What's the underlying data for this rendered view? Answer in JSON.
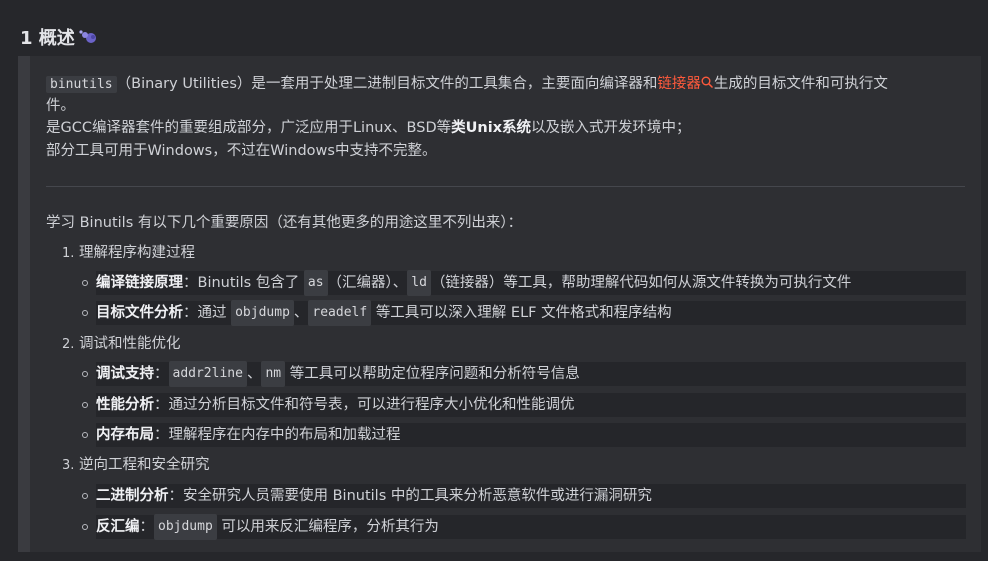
{
  "heading": {
    "title": "1 概述"
  },
  "intro": {
    "code1": "binutils",
    "text1": "（Binary Utilities）是一套用于处理二进制目标文件的工具集合，主要面向编译器和",
    "link": "链接器",
    "text2": "生成的目标文件和可执行文",
    "text3": "件。",
    "line2_a": "是GCC编译器套件的重要组成部分，广泛应用于Linux、BSD等",
    "line2_bold": "类Unix系统",
    "line2_b": "以及嵌入式开发环境中；",
    "line3": "部分工具可用于Windows，不过在Windows中支持不完整。"
  },
  "reasons": {
    "lead": "学习 Binutils 有以下几个重要原因（还有其他更多的用途这里不列出来）：",
    "items": [
      {
        "num": "1.",
        "title": "理解程序构建过程",
        "subs": [
          {
            "bold": "编译链接原理",
            "pre": "：Binutils 包含了",
            "code1": "as",
            "mid": "（汇编器）、",
            "code2": "ld",
            "post": "（链接器）等工具，帮助理解代码如何从源文件转换为可执行文件"
          },
          {
            "bold": "目标文件分析",
            "pre": "：通过",
            "code1": "objdump",
            "mid": "、",
            "code2": "readelf",
            "post": "等工具可以深入理解 ELF 文件格式和程序结构"
          }
        ]
      },
      {
        "num": "2.",
        "title": "调试和性能优化",
        "subs": [
          {
            "bold": "调试支持",
            "pre": "：",
            "code1": "addr2line",
            "mid": "、",
            "code2": "nm",
            "post": "等工具可以帮助定位程序问题和分析符号信息"
          },
          {
            "bold": "性能分析",
            "pre": "：通过分析目标文件和符号表，可以进行程序大小优化和性能调优"
          },
          {
            "bold": "内存布局",
            "pre": "：理解程序在内存中的布局和加载过程"
          }
        ]
      },
      {
        "num": "3.",
        "title": "逆向工程和安全研究",
        "subs": [
          {
            "bold": "二进制分析",
            "pre": "：安全研究人员需要使用 Binutils 中的工具来分析恶意软件或进行漏洞研究"
          },
          {
            "bold": "反汇编",
            "pre": "：",
            "code1": "objdump",
            "post": "可以用来反汇编程序，分析其行为"
          }
        ]
      }
    ]
  },
  "colors": {
    "background": "#26272b",
    "block": "#2e2f33",
    "link": "#ff5a3c"
  },
  "icons": {
    "heading_icon": "sparkle-icon",
    "link_icon": "search-icon"
  }
}
